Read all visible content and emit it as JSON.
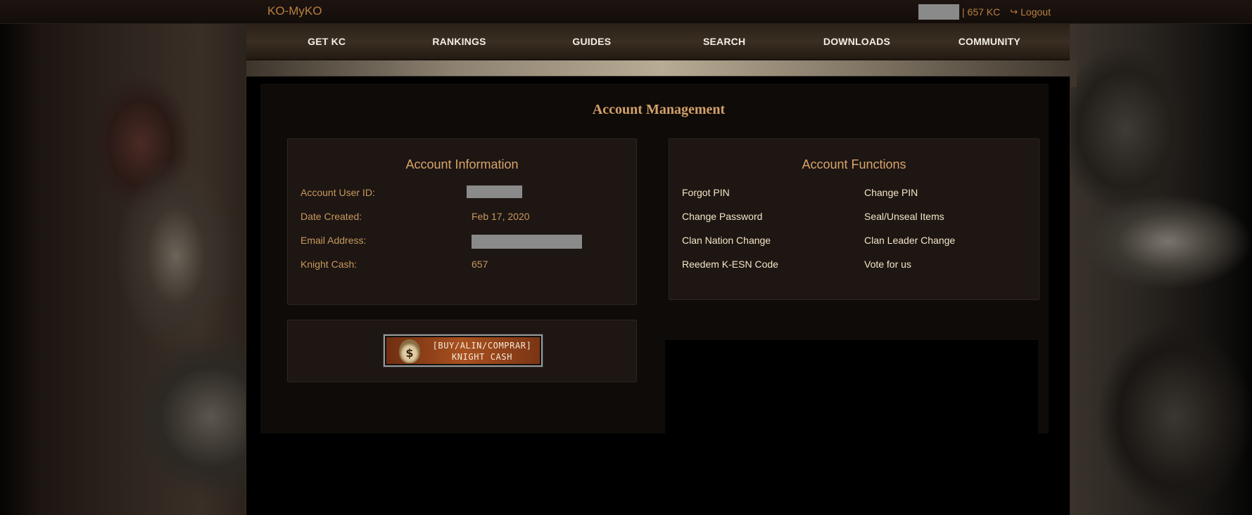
{
  "topbar": {
    "brand": "KO-MyKO",
    "kc_balance": "| 657 KC",
    "logout_label": "Logout"
  },
  "nav": {
    "items": [
      "GET KC",
      "RANKINGS",
      "GUIDES",
      "SEARCH",
      "DOWNLOADS",
      "COMMUNITY"
    ]
  },
  "page": {
    "title": "Account Management"
  },
  "account_info": {
    "title": "Account Information",
    "user_id_label": "Account User ID:",
    "date_created_label": "Date Created:",
    "date_created_value": "Feb 17, 2020",
    "email_label": "Email Address:",
    "knight_cash_label": "Knight Cash:",
    "knight_cash_value": "657"
  },
  "account_functions": {
    "title": "Account Functions",
    "links": [
      "Forgot PIN",
      "Change PIN",
      "Change Password",
      "Seal/Unseal Items",
      "Clan Nation Change",
      "Clan Leader Change",
      "Reedem K-ESN Code",
      "Vote for us"
    ]
  },
  "buy_button": {
    "line1": "[BUY/ALIN/COMPRAR]",
    "line2": "KNIGHT CASH",
    "icon": "$"
  },
  "colors": {
    "accent": "#b9803f",
    "title": "#d2a06a",
    "link": "#f4e6c6"
  }
}
